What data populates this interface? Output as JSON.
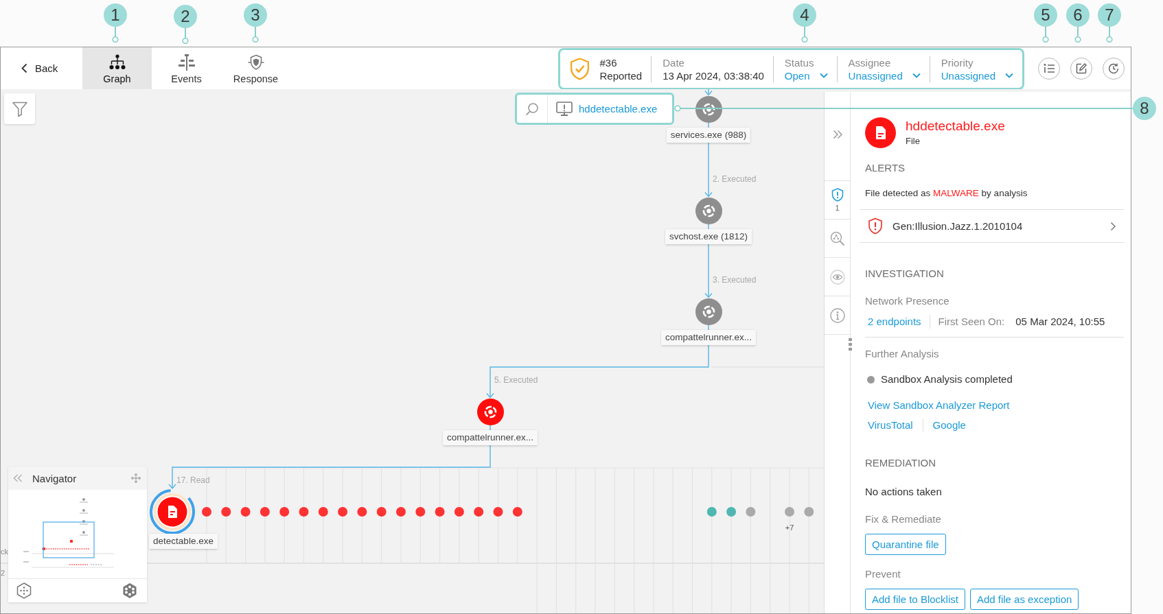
{
  "callouts": [
    "1",
    "2",
    "3",
    "4",
    "5",
    "6",
    "7",
    "8"
  ],
  "toolbar": {
    "back": "Back",
    "tabs": [
      {
        "label": "Graph",
        "kind": "graph",
        "selected": true
      },
      {
        "label": "Events",
        "kind": "events",
        "selected": false
      },
      {
        "label": "Response",
        "kind": "response",
        "selected": false
      }
    ]
  },
  "incident": {
    "number": "#36",
    "state": "Reported",
    "fields": [
      {
        "label": "Date",
        "value": "13 Apr 2024, 03:38:40",
        "kind": "text"
      },
      {
        "label": "Status",
        "value": "Open",
        "kind": "dropdown"
      },
      {
        "label": "Assignee",
        "value": "Unassigned",
        "kind": "dropdown"
      },
      {
        "label": "Priority",
        "value": "Unassigned",
        "kind": "dropdown"
      }
    ]
  },
  "actions": [
    {
      "kind": "list"
    },
    {
      "kind": "edit"
    },
    {
      "kind": "history"
    }
  ],
  "graph": {
    "focus": {
      "label": "hddetectable.exe"
    },
    "nodes": [
      {
        "name": "services.exe (988)",
        "kind": "process",
        "malicious": false,
        "selected": false
      },
      {
        "name": "svchost.exe (1812)",
        "kind": "process",
        "malicious": false,
        "selected": false,
        "edge_label": "2. Executed"
      },
      {
        "name": "compattelrunner.ex...",
        "kind": "process",
        "malicious": false,
        "selected": false,
        "edge_label": "3. Executed"
      },
      {
        "name": "compattelrunner.ex...",
        "kind": "process",
        "malicious": true,
        "selected": false,
        "edge_label": "5. Executed"
      },
      {
        "name": "detectable.exe",
        "kind": "file",
        "malicious": true,
        "selected": true,
        "edge_label": "17. Read"
      }
    ],
    "timeline": [
      {
        "dots": [
          {
            "color": "#ff3333"
          },
          {
            "color": "#ff3333"
          },
          {
            "color": "#ff3333"
          },
          {
            "color": "#ff3333"
          },
          {
            "color": "#ff3333"
          },
          {
            "color": "#ff3333"
          },
          {
            "color": "#ff3333"
          },
          {
            "color": "#ff3333"
          },
          {
            "color": "#ff3333"
          },
          {
            "color": "#ff3333"
          },
          {
            "color": "#ff3333"
          },
          {
            "color": "#ff3333"
          },
          {
            "color": "#ff3333"
          },
          {
            "color": "#ff3333"
          },
          {
            "color": "#ff3333"
          },
          {
            "color": "#ff3333"
          },
          {
            "color": "#ff3333"
          }
        ]
      },
      {
        "dots": [
          {
            "color": "#4fb7b0"
          },
          {
            "color": "#4fb7b0"
          },
          {
            "color": "#aaaaaa"
          }
        ]
      },
      {
        "dots": [
          {
            "color": "#aaaaaa",
            "count": "+7"
          },
          {
            "color": "#aaaaaa"
          }
        ]
      }
    ],
    "edge_fragments": [
      "ck",
      "2"
    ],
    "navigator": {
      "title": "Navigator"
    }
  },
  "panel": {
    "rail": {
      "tabs": [
        {
          "kind": "alerts",
          "count": "1",
          "selected": true
        },
        {
          "kind": "search",
          "selected": false
        },
        {
          "kind": "network",
          "selected": false
        },
        {
          "kind": "info",
          "selected": false
        }
      ]
    },
    "title": "hddetectable.exe",
    "type": "File",
    "alerts": {
      "heading": "ALERTS",
      "summary": [
        {
          "text": "File detected as",
          "highlight": false
        },
        {
          "text": "MALWARE",
          "highlight": true
        },
        {
          "text": "by analysis",
          "highlight": false
        }
      ],
      "items": [
        {
          "name": "Gen:Illusion.Jazz.1.2010104"
        }
      ]
    },
    "investigation": {
      "heading": "INVESTIGATION",
      "network": {
        "label": "Network Presence",
        "endpoints": "2 endpoints",
        "first_seen_label": "First Seen On:",
        "first_seen": "05 Mar 2024, 10:55"
      },
      "analysis": {
        "label": "Further Analysis",
        "status": "Sandbox Analysis completed",
        "report_link": "View Sandbox Analyzer Report",
        "lookups": [
          "VirusTotal",
          "Google"
        ]
      }
    },
    "remediation": {
      "heading": "REMEDIATION",
      "status": "No actions taken",
      "groups": [
        {
          "label": "Fix & Remediate",
          "actions": [
            "Quarantine file"
          ]
        },
        {
          "label": "Prevent",
          "actions": [
            "Add file to Blocklist",
            "Add file as exception"
          ]
        }
      ]
    }
  }
}
